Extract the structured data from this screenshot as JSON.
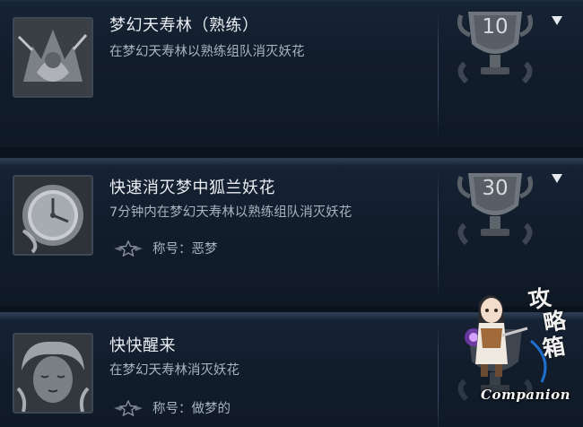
{
  "achievements": [
    {
      "title": "梦幻天寿林（熟练）",
      "description": "在梦幻天寿林以熟练组队消灭妖花",
      "points": "10",
      "thumb_icon": "armored-warrior-portrait-icon",
      "expandable": true
    },
    {
      "title": "快速消灭梦中狐兰妖花",
      "description": "7分钟内在梦幻天寿林以熟练组队消灭妖花",
      "points": "30",
      "thumb_icon": "clock-icon",
      "reward_label": "称号：恶梦",
      "expandable": true
    },
    {
      "title": "快快醒来",
      "description": "在梦幻天寿林消灭妖花",
      "thumb_icon": "sleeping-face-portrait-icon",
      "reward_label": "称号：做梦的",
      "expandable": false
    }
  ],
  "watermark": {
    "label": "Companion",
    "chars": [
      "攻",
      "略",
      "箱"
    ],
    "icon": "chibi-mascot-icon"
  },
  "colors": {
    "background": "#0e1826",
    "title_text": "#e9edf2",
    "desc_text": "#a9b3bf",
    "trophy": "#6f757c"
  }
}
